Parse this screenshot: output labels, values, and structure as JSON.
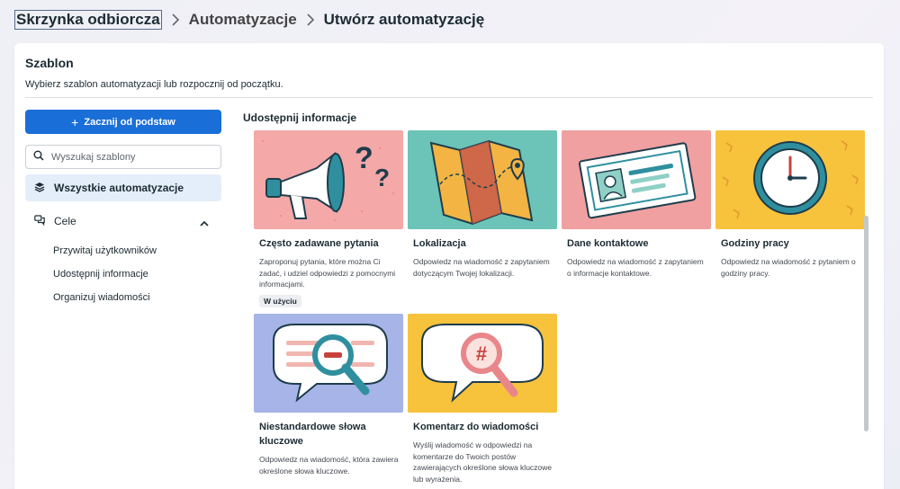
{
  "breadcrumb": {
    "inbox": "Skrzynka odbiorcza",
    "automations": "Automatyzacje",
    "current": "Utwórz automatyzację"
  },
  "panel": {
    "title": "Szablon",
    "subtitle": "Wybierz szablon automatyzacji lub rozpocznij od początku."
  },
  "sidebar": {
    "start_button": "Zacznij od podstaw",
    "search_placeholder": "Wyszukaj szablony",
    "all_label": "Wszystkie automatyzacje",
    "group_label": "Cele",
    "items": [
      "Przywitaj użytkowników",
      "Udostępnij informacje",
      "Organizuj wiadomości"
    ]
  },
  "section_title": "Udostępnij informacje",
  "cards": [
    {
      "title": "Często zadawane pytania",
      "desc": "Zaproponuj pytania, które można Ci zadać, i udziel odpowiedzi z pomocnymi informacjami.",
      "badge": "W użyciu",
      "bg": "#f5a8a8"
    },
    {
      "title": "Lokalizacja",
      "desc": "Odpowiedz na wiadomość z zapytaniem dotyczącym Twojej lokalizacji.",
      "bg": "#6cc3b8"
    },
    {
      "title": "Dane kontaktowe",
      "desc": "Odpowiedz na wiadomość z zapytaniem o informacje kontaktowe.",
      "bg": "#f0a0a0"
    },
    {
      "title": "Godziny pracy",
      "desc": "Odpowiedz na wiadomość z pytaniem o godziny pracy.",
      "bg": "#f7c23c"
    },
    {
      "title": "Niestandardowe słowa kluczowe",
      "desc": "Odpowiedz na wiadomość, która zawiera określone słowa kluczowe.",
      "bg": "#a6b4e8"
    },
    {
      "title": "Komentarz do wiadomości",
      "desc": "Wyślij wiadomość w odpowiedzi na komentarze do Twoich postów zawierających określone słowa kluczowe lub wyrażenia.",
      "bg": "#f7c23c"
    }
  ],
  "icons": {
    "chevron_right": "chevron-right-icon",
    "plus": "plus-icon",
    "search": "search-icon",
    "stack": "stack-icon",
    "chat": "chat-bubbles-icon",
    "chevron_up": "chevron-up-icon"
  },
  "colors": {
    "primary": "#1a6ed8",
    "selected_nav": "#e4eefa"
  }
}
